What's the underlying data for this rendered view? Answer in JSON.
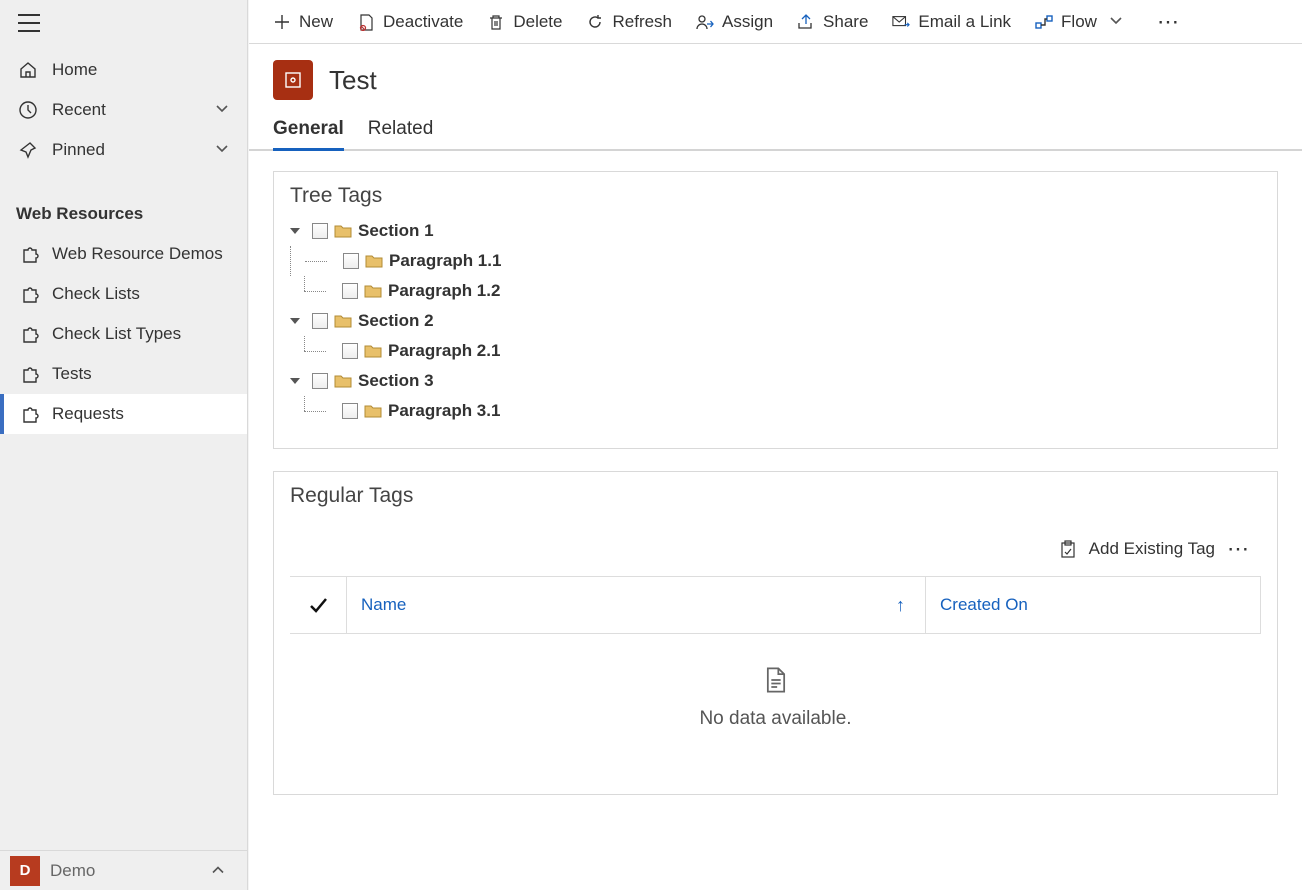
{
  "sidebar": {
    "items": [
      {
        "label": "Home",
        "icon": "house",
        "chevron": false
      },
      {
        "label": "Recent",
        "icon": "clock",
        "chevron": true
      },
      {
        "label": "Pinned",
        "icon": "pin",
        "chevron": true
      }
    ],
    "section_header": "Web Resources",
    "resources": [
      {
        "label": "Web Resource Demos",
        "selected": false
      },
      {
        "label": "Check Lists",
        "selected": false
      },
      {
        "label": "Check List Types",
        "selected": false
      },
      {
        "label": "Tests",
        "selected": false
      },
      {
        "label": "Requests",
        "selected": true
      }
    ],
    "app_tile_letter": "D",
    "app_name": "Demo"
  },
  "commands": {
    "new": "New",
    "deactivate": "Deactivate",
    "delete": "Delete",
    "refresh": "Refresh",
    "assign": "Assign",
    "share": "Share",
    "email_link": "Email a Link",
    "flow": "Flow"
  },
  "record": {
    "title": "Test"
  },
  "tabs": {
    "general": "General",
    "related": "Related"
  },
  "tree_panel": {
    "title": "Tree Tags",
    "nodes": [
      {
        "label": "Section 1",
        "level": 0
      },
      {
        "label": "Paragraph 1.1",
        "level": 1
      },
      {
        "label": "Paragraph 1.2",
        "level": 1
      },
      {
        "label": "Section 2",
        "level": 0
      },
      {
        "label": "Paragraph 2.1",
        "level": 1
      },
      {
        "label": "Section 3",
        "level": 0
      },
      {
        "label": "Paragraph 3.1",
        "level": 1
      }
    ]
  },
  "tags_panel": {
    "title": "Regular Tags",
    "add_existing": "Add Existing Tag",
    "columns": {
      "name": "Name",
      "created_on": "Created On"
    },
    "empty_msg": "No data available."
  }
}
